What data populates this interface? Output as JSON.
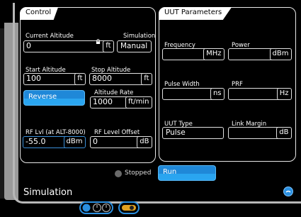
{
  "control": {
    "title": "Control",
    "current_altitude_label": "Current Altitude",
    "current_altitude_value": "0",
    "current_altitude_unit": "ft",
    "simulation_label": "Simulation",
    "simulation_mode": "Manual",
    "start_altitude_label": "Start Altitude",
    "start_altitude_value": "100",
    "start_altitude_unit": "ft",
    "stop_altitude_label": "Stop Altitude",
    "stop_altitude_value": "8000",
    "stop_altitude_unit": "ft",
    "reverse_label": "Reverse",
    "altitude_rate_label": "Altitude Rate",
    "altitude_rate_value": "1000",
    "altitude_rate_unit": "ft/min",
    "rf_lvl_label": "RF Lvl (at ALT-8000)",
    "rf_lvl_value": "-55.0",
    "rf_lvl_unit": "dBm",
    "rf_offset_label": "RF Level Offset",
    "rf_offset_value": "0",
    "rf_offset_unit": "dB"
  },
  "uut": {
    "title": "UUT Parameters",
    "frequency_label": "Frequency",
    "frequency_value": "",
    "frequency_unit": "MHz",
    "power_label": "Power",
    "power_value": "",
    "power_unit": "dBm",
    "pulse_width_label": "Pulse Width",
    "pulse_width_value": "",
    "pulse_width_unit": "ns",
    "prf_label": "PRF",
    "prf_value": "",
    "prf_unit": "Hz",
    "uut_type_label": "UUT Type",
    "uut_type_value": "Pulse",
    "link_margin_label": "Link Margin",
    "link_margin_value": "",
    "link_margin_unit": "dB"
  },
  "status": {
    "text": "Stopped"
  },
  "run_label": "Run",
  "screen_title": "Simulation",
  "colors": {
    "accent": "#1f88d8",
    "frame": "#b7b7b7",
    "toggle": "#e0a020"
  },
  "icons": [
    "lock-icon",
    "info-icon",
    "power-icon",
    "toggle-icon"
  ]
}
